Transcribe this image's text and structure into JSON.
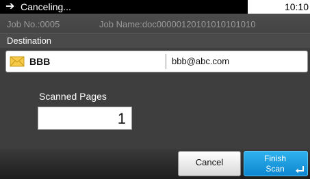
{
  "status_bar": {
    "arrow_glyph": "➔",
    "status_text": "Canceling...",
    "clock": "10:10"
  },
  "job_info": {
    "job_no": "Job No.:0005",
    "job_name": "Job Name:doc00000120101010101010"
  },
  "destination": {
    "section_label": "Destination",
    "name": "BBB",
    "email": "bbb@abc.com",
    "icon": "mail-icon"
  },
  "scanned_pages": {
    "label": "Scanned Pages",
    "value": "1"
  },
  "footer": {
    "cancel_label": "Cancel",
    "finish_line1": "Finish",
    "finish_line2": "Scan",
    "enter_icon": "enter-icon"
  },
  "colors": {
    "accent_blue": "#1a9ae0",
    "mail_icon": "#f7c948"
  }
}
